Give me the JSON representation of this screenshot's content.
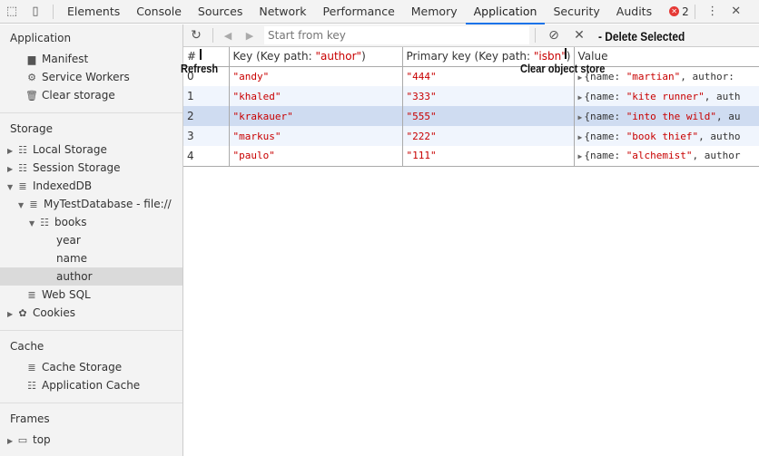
{
  "tabs": [
    "Elements",
    "Console",
    "Sources",
    "Network",
    "Performance",
    "Memory",
    "Application",
    "Security",
    "Audits"
  ],
  "active_tab": "Application",
  "error_count": "2",
  "sidebar": {
    "application_header": "Application",
    "application_items": [
      "Manifest",
      "Service Workers",
      "Clear storage"
    ],
    "storage_header": "Storage",
    "storage_items": [
      "Local Storage",
      "Session Storage",
      "IndexedDB",
      "MyTestDatabase - file://",
      "books",
      "year",
      "name",
      "author",
      "Web SQL",
      "Cookies"
    ],
    "cache_header": "Cache",
    "cache_items": [
      "Cache Storage",
      "Application Cache"
    ],
    "frames_header": "Frames",
    "frames_items": [
      "top"
    ]
  },
  "toolbar": {
    "search_placeholder": "Start from key"
  },
  "annotations": {
    "refresh": "Refresh",
    "clear": "Clear object store",
    "delete": "- Delete Selected"
  },
  "table": {
    "headers": {
      "num": "#",
      "key_prefix": "Key (Key path: ",
      "key_path": "\"author\"",
      "primary_prefix": "Primary key (Key path: ",
      "primary_path": "\"isbn\"",
      "close": ")",
      "value": "Value"
    },
    "rows": [
      {
        "n": "0",
        "key": "\"andy\"",
        "pk": "\"444\"",
        "v_pre": "{name: ",
        "v_name": "\"martian\"",
        "v_post": ", author: "
      },
      {
        "n": "1",
        "key": "\"khaled\"",
        "pk": "\"333\"",
        "v_pre": "{name: ",
        "v_name": "\"kite runner\"",
        "v_post": ", auth"
      },
      {
        "n": "2",
        "key": "\"krakauer\"",
        "pk": "\"555\"",
        "v_pre": "{name: ",
        "v_name": "\"into the wild\"",
        "v_post": ", au"
      },
      {
        "n": "3",
        "key": "\"markus\"",
        "pk": "\"222\"",
        "v_pre": "{name: ",
        "v_name": "\"book thief\"",
        "v_post": ", autho"
      },
      {
        "n": "4",
        "key": "\"paulo\"",
        "pk": "\"111\"",
        "v_pre": "{name: ",
        "v_name": "\"alchemist\"",
        "v_post": ", author"
      }
    ],
    "selected_row": 2
  }
}
